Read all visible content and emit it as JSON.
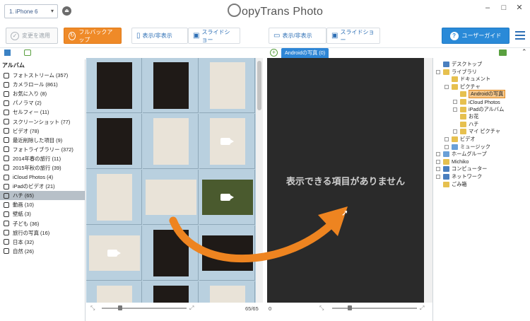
{
  "titlebar": {
    "device": "1. iPhone 6",
    "app_title": "opyTrans Photo"
  },
  "toolbar": {
    "apply_label": "変更を適用",
    "backup_label": "フルバックアップ",
    "toggle_left_label": "表示/非表示",
    "slideshow_left_label": "スライドショー",
    "toggle_right_label": "表示/非表示",
    "slideshow_right_label": "スライドショー",
    "guide_label": "ユーザーガイド"
  },
  "albums": {
    "title": "アルバム",
    "items": [
      {
        "label": "フォトストリーム (357)",
        "icon": "cloud-icon"
      },
      {
        "label": "カメラロール (861)",
        "icon": "camera-roll-icon"
      },
      {
        "label": "お気に入り (8)",
        "icon": "heart-icon"
      },
      {
        "label": "パノラマ (2)",
        "icon": "panorama-icon"
      },
      {
        "label": "セルフィー (11)",
        "icon": "camera-icon"
      },
      {
        "label": "スクリーンショット (77)",
        "icon": "phone-icon"
      },
      {
        "label": "ビデオ (78)",
        "icon": "video-icon"
      },
      {
        "label": "最近削除した項目 (9)",
        "icon": "trash-icon"
      },
      {
        "label": "フォトライブラリー (372)",
        "icon": "camera-icon"
      },
      {
        "label": "2014年春の旅行 (11)",
        "icon": "album-icon"
      },
      {
        "label": "2015年秋の旅行 (39)",
        "icon": "album-icon"
      },
      {
        "label": "iCloud Photos (4)",
        "icon": "album-icon"
      },
      {
        "label": "iPadのビデオ (21)",
        "icon": "album-icon"
      },
      {
        "label": "ハチ (65)",
        "icon": "album-icon",
        "selected": true
      },
      {
        "label": "動画 (10)",
        "icon": "album-icon"
      },
      {
        "label": "壁紙 (3)",
        "icon": "album-icon"
      },
      {
        "label": "子ども (36)",
        "icon": "album-icon"
      },
      {
        "label": "旅行の写真 (16)",
        "icon": "album-icon"
      },
      {
        "label": "日本 (32)",
        "icon": "album-icon"
      },
      {
        "label": "自然 (26)",
        "icon": "album-icon"
      }
    ]
  },
  "device_panel": {
    "count": "65/65"
  },
  "pc_panel": {
    "tab_label": "Androidの写真 (0)",
    "empty_message": "表示できる項目がありません",
    "count": "0"
  },
  "tree": {
    "items": [
      {
        "label": "デスクトップ",
        "icon": "desktop-icon"
      },
      {
        "label": "ライブラリ",
        "icon": "folder-icon"
      },
      {
        "label": "ドキュメント",
        "icon": "folder-icon"
      },
      {
        "label": "ピクチャ",
        "icon": "folder-icon"
      },
      {
        "label": "Androidの写真",
        "icon": "folder-icon",
        "selected": true
      },
      {
        "label": "iCloud Photos",
        "icon": "folder-icon"
      },
      {
        "label": "iPadのアルバム",
        "icon": "folder-icon"
      },
      {
        "label": "お花",
        "icon": "folder-icon"
      },
      {
        "label": "ハチ",
        "icon": "folder-icon"
      },
      {
        "label": "マイ ピクチャ",
        "icon": "folder-icon"
      },
      {
        "label": "ビデオ",
        "icon": "folder-icon"
      },
      {
        "label": "ミュージック",
        "icon": "music-icon"
      },
      {
        "label": "ホームグループ",
        "icon": "homegroup-icon"
      },
      {
        "label": "Michiko",
        "icon": "user-folder-icon"
      },
      {
        "label": "コンピューター",
        "icon": "computer-icon"
      },
      {
        "label": "ネットワーク",
        "icon": "network-icon"
      },
      {
        "label": "ごみ箱",
        "icon": "recycle-bin-icon"
      }
    ]
  },
  "colors": {
    "accent_orange": "#ef8a28",
    "accent_blue": "#2a8ad8",
    "selected_album": "#b7c0c8"
  }
}
